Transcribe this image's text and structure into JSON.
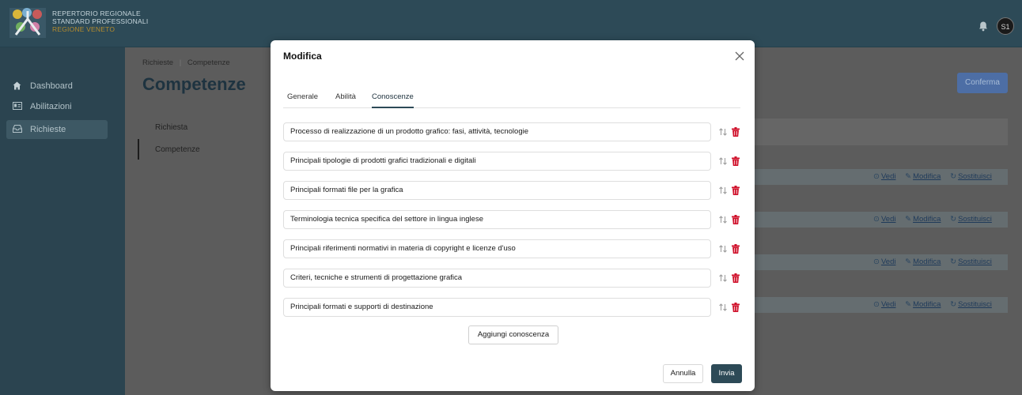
{
  "header": {
    "logo_line1": "REPERTORIO REGIONALE",
    "logo_line2": "STANDARD PROFESSIONALI",
    "logo_line3": "REGIONE VENETO",
    "avatar_initials": "S1"
  },
  "sidebar": {
    "items": [
      {
        "label": "Dashboard",
        "icon": "home-icon"
      },
      {
        "label": "Abilitazioni",
        "icon": "id-card-icon"
      },
      {
        "label": "Richieste",
        "icon": "inbox-icon"
      }
    ]
  },
  "page": {
    "breadcrumb_1": "Richieste",
    "breadcrumb_sep": "|",
    "breadcrumb_2": "Competenze",
    "title": "Competenze",
    "confirm_label": "Conferma",
    "steps": [
      "Richiesta",
      "Competenze"
    ],
    "row_actions": {
      "view": "Vedi",
      "edit": "Modifica",
      "replace": "Sostituisci"
    }
  },
  "modal": {
    "title": "Modifica",
    "tabs": [
      "Generale",
      "Abilità",
      "Conoscenze"
    ],
    "active_tab": "Conoscenze",
    "items": [
      "Processo di realizzazione di un prodotto grafico: fasi, attività, tecnologie",
      "Principali tipologie di prodotti grafici tradizionali e digitali",
      "Principali formati file per la grafica",
      "Terminologia tecnica specifica del settore in lingua inglese",
      "Principali riferimenti normativi in materia di copyright e licenze d'uso",
      "Criteri, tecniche e strumenti di progettazione grafica",
      "Principali formati e supporti di destinazione"
    ],
    "add_label": "Aggiungi conoscenza",
    "cancel_label": "Annulla",
    "submit_label": "Invia"
  },
  "colors": {
    "primary": "#2d4a57",
    "delete": "#d0112b",
    "confirm_disabled": "#4d6ea5"
  }
}
